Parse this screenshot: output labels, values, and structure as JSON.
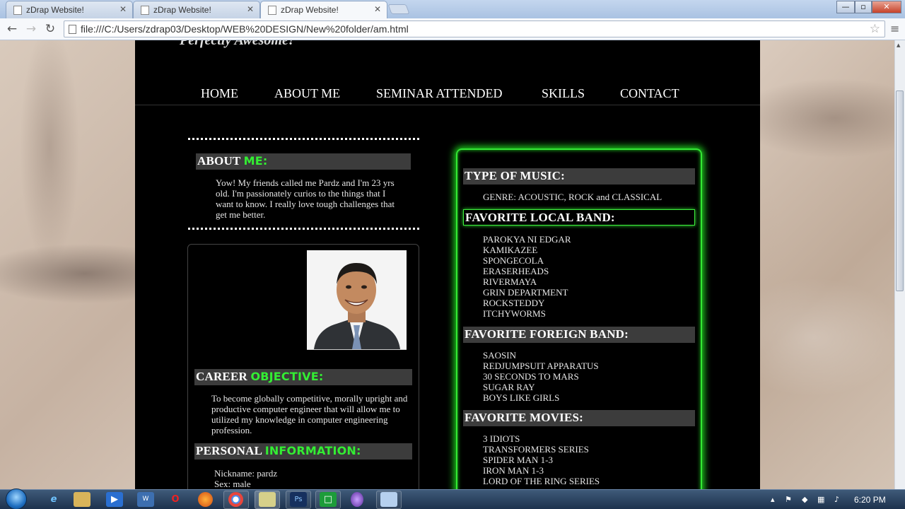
{
  "browser": {
    "tabs": [
      {
        "title": "zDrap Website!",
        "active": false
      },
      {
        "title": "zDrap Website!",
        "active": false
      },
      {
        "title": "zDrap Website!",
        "active": true
      }
    ],
    "url": "file:///C:/Users/zdrap03/Desktop/WEB%20DESIGN/New%20folder/am.html",
    "nav_icons": {
      "back": "←",
      "forward": "→",
      "reload": "↻",
      "star": "☆",
      "menu": "≡"
    },
    "window_buttons": {
      "minimize": "—",
      "maximize": "▫",
      "close": "✕"
    }
  },
  "site": {
    "title": "Perfectly Awesome!",
    "nav": [
      "HOME",
      "ABOUT ME",
      "SEMINAR ATTENDED",
      "SKILLS",
      "CONTACT"
    ]
  },
  "about": {
    "heading": "ABOUT ",
    "heading_accent": "ME:",
    "text": "Yow! My friends called me Pardz and I'm 23 yrs old. I'm passionately curios to the things that I want to know. I really love tough challenges that get me better."
  },
  "career": {
    "heading": "CAREER ",
    "heading_accent": "OBJECTIVE:",
    "text": "To become globally competitive, morally upright and productive computer engineer that will allow me to utilized my knowledge in computer engineering profession."
  },
  "personal": {
    "heading": "PERSONAL ",
    "heading_accent": "INFORMATION:",
    "lines": [
      "Nickname: pardz",
      "Sex: male"
    ]
  },
  "music": {
    "heading": "TYPE OF MUSIC:",
    "genre": "GENRE: ACOUSTIC, ROCK and CLASSICAL"
  },
  "local_bands": {
    "heading": "FAVORITE LOCAL BAND:",
    "items": [
      "PAROKYA NI EDGAR",
      "KAMIKAZEE",
      "SPONGECOLA",
      "ERASERHEADS",
      "RIVERMAYA",
      "GRIN DEPARTMENT",
      "ROCKSTEDDY",
      "ITCHYWORMS"
    ]
  },
  "foreign_bands": {
    "heading": "FAVORITE FOREIGN BAND:",
    "items": [
      "SAOSIN",
      "REDJUMPSUIT APPARATUS",
      "30 SECONDS TO MARS",
      "SUGAR RAY",
      "BOYS LIKE GIRLS"
    ]
  },
  "movies": {
    "heading": "FAVORITE MOVIES:",
    "items": [
      "3 IDIOTS",
      "TRANSFORMERS SERIES",
      "SPIDER MAN 1-3",
      "IRON MAN 1-3",
      "LORD OF THE RING SERIES"
    ]
  },
  "taskbar": {
    "clock": "6:20 PM"
  },
  "colors": {
    "accent": "#33ee33",
    "page_bg": "#000000",
    "heading_bg": "#3c3c3c"
  }
}
